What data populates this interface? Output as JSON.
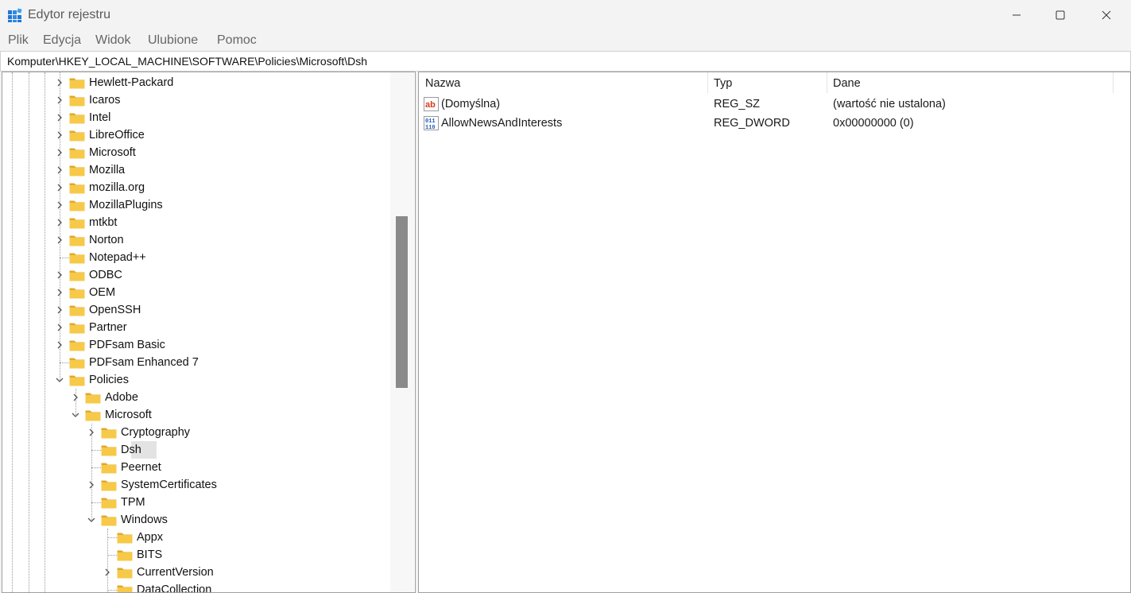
{
  "window": {
    "title": "Edytor rejestru",
    "minimize_icon": "minimize-icon",
    "maximize_icon": "maximize-icon",
    "close_icon": "close-icon"
  },
  "menu": {
    "items": [
      "Plik",
      "Edycja",
      "Widok",
      "Ulubione",
      "Pomoc"
    ]
  },
  "address": {
    "path": "Komputer\\HKEY_LOCAL_MACHINE\\SOFTWARE\\Policies\\Microsoft\\Dsh"
  },
  "tree": {
    "selected": "Dsh",
    "nodes": [
      {
        "label": "Hewlett-Packard",
        "depth": 0,
        "expander": "collapsed"
      },
      {
        "label": "Icaros",
        "depth": 0,
        "expander": "collapsed"
      },
      {
        "label": "Intel",
        "depth": 0,
        "expander": "collapsed"
      },
      {
        "label": "LibreOffice",
        "depth": 0,
        "expander": "collapsed"
      },
      {
        "label": "Microsoft",
        "depth": 0,
        "expander": "collapsed"
      },
      {
        "label": "Mozilla",
        "depth": 0,
        "expander": "collapsed"
      },
      {
        "label": "mozilla.org",
        "depth": 0,
        "expander": "collapsed"
      },
      {
        "label": "MozillaPlugins",
        "depth": 0,
        "expander": "collapsed"
      },
      {
        "label": "mtkbt",
        "depth": 0,
        "expander": "collapsed"
      },
      {
        "label": "Norton",
        "depth": 0,
        "expander": "collapsed"
      },
      {
        "label": "Notepad++",
        "depth": 0,
        "expander": "none"
      },
      {
        "label": "ODBC",
        "depth": 0,
        "expander": "collapsed"
      },
      {
        "label": "OEM",
        "depth": 0,
        "expander": "collapsed"
      },
      {
        "label": "OpenSSH",
        "depth": 0,
        "expander": "collapsed"
      },
      {
        "label": "Partner",
        "depth": 0,
        "expander": "collapsed"
      },
      {
        "label": "PDFsam Basic",
        "depth": 0,
        "expander": "collapsed"
      },
      {
        "label": "PDFsam Enhanced 7",
        "depth": 0,
        "expander": "none"
      },
      {
        "label": "Policies",
        "depth": 0,
        "expander": "expanded"
      },
      {
        "label": "Adobe",
        "depth": 1,
        "expander": "collapsed"
      },
      {
        "label": "Microsoft",
        "depth": 1,
        "expander": "expanded"
      },
      {
        "label": "Cryptography",
        "depth": 2,
        "expander": "collapsed"
      },
      {
        "label": "Dsh",
        "depth": 2,
        "expander": "none"
      },
      {
        "label": "Peernet",
        "depth": 2,
        "expander": "none"
      },
      {
        "label": "SystemCertificates",
        "depth": 2,
        "expander": "collapsed"
      },
      {
        "label": "TPM",
        "depth": 2,
        "expander": "none"
      },
      {
        "label": "Windows",
        "depth": 2,
        "expander": "expanded"
      },
      {
        "label": "Appx",
        "depth": 3,
        "expander": "none"
      },
      {
        "label": "BITS",
        "depth": 3,
        "expander": "none"
      },
      {
        "label": "CurrentVersion",
        "depth": 3,
        "expander": "collapsed"
      },
      {
        "label": "DataCollection",
        "depth": 3,
        "expander": "none"
      }
    ]
  },
  "list": {
    "columns": [
      "Nazwa",
      "Typ",
      "Dane"
    ],
    "rows": [
      {
        "icon": "string-value-icon",
        "name": "(Domyślna)",
        "type": "REG_SZ",
        "data": "(wartość nie ustalona)"
      },
      {
        "icon": "binary-value-icon",
        "name": "AllowNewsAndInterests",
        "type": "REG_DWORD",
        "data": "0x00000000 (0)"
      }
    ]
  },
  "colors": {
    "folder": "#f7c948",
    "folder_dark": "#e0a92a",
    "selected_bg": "#e3e3e3",
    "scroll_thumb": "#8a8a8a"
  }
}
